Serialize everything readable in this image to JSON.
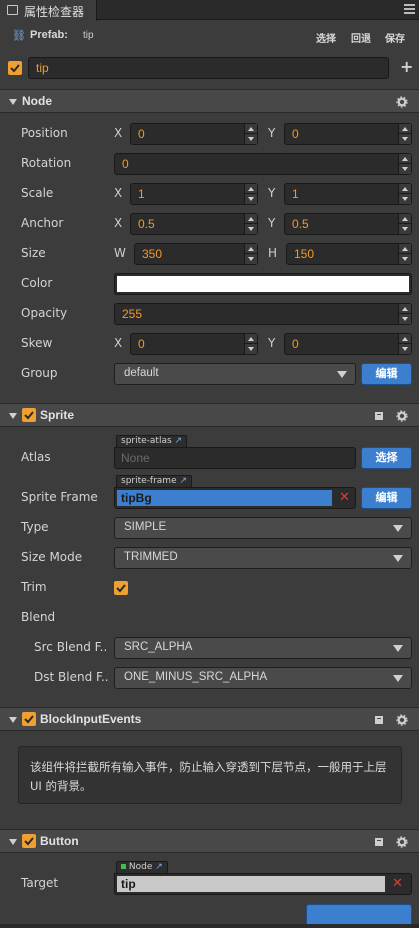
{
  "panel": {
    "tab_title": "属性检查器"
  },
  "prefab": {
    "label": "Prefab:",
    "name": "tip",
    "select": "选择",
    "revert": "回退",
    "save": "保存"
  },
  "node_name": "tip",
  "node": {
    "title": "Node",
    "position": {
      "label": "Position",
      "x_label": "X",
      "x": "0",
      "y_label": "Y",
      "y": "0"
    },
    "rotation": {
      "label": "Rotation",
      "value": "0"
    },
    "scale": {
      "label": "Scale",
      "x_label": "X",
      "x": "1",
      "y_label": "Y",
      "y": "1"
    },
    "anchor": {
      "label": "Anchor",
      "x_label": "X",
      "x": "0.5",
      "y_label": "Y",
      "y": "0.5"
    },
    "size": {
      "label": "Size",
      "w_label": "W",
      "w": "350",
      "h_label": "H",
      "h": "150"
    },
    "color": {
      "label": "Color",
      "value": "#ffffff"
    },
    "opacity": {
      "label": "Opacity",
      "value": "255"
    },
    "skew": {
      "label": "Skew",
      "x_label": "X",
      "x": "0",
      "y_label": "Y",
      "y": "0"
    },
    "group": {
      "label": "Group",
      "value": "default",
      "edit": "编辑"
    }
  },
  "sprite": {
    "title": "Sprite",
    "atlas": {
      "label": "Atlas",
      "tag": "sprite-atlas",
      "value": "None",
      "button": "选择"
    },
    "frame": {
      "label": "Sprite Frame",
      "tag": "sprite-frame",
      "value": "tipBg",
      "button": "编辑"
    },
    "type": {
      "label": "Type",
      "value": "SIMPLE"
    },
    "size_mode": {
      "label": "Size Mode",
      "value": "TRIMMED"
    },
    "trim": {
      "label": "Trim",
      "checked": true
    },
    "blend": {
      "label": "Blend"
    },
    "src_blend": {
      "label": "Src Blend F..",
      "value": "SRC_ALPHA"
    },
    "dst_blend": {
      "label": "Dst Blend F..",
      "value": "ONE_MINUS_SRC_ALPHA"
    }
  },
  "block_input": {
    "title": "BlockInputEvents",
    "description": "该组件将拦截所有输入事件，防止输入穿透到下层节点，一般用于上层 UI 的背景。"
  },
  "button": {
    "title": "Button",
    "target": {
      "label": "Target",
      "tag": "Node",
      "value": "tip"
    }
  },
  "colors": {
    "accent": "#f0a030",
    "blue": "#3d7fcf",
    "number": "#f19a2f"
  }
}
